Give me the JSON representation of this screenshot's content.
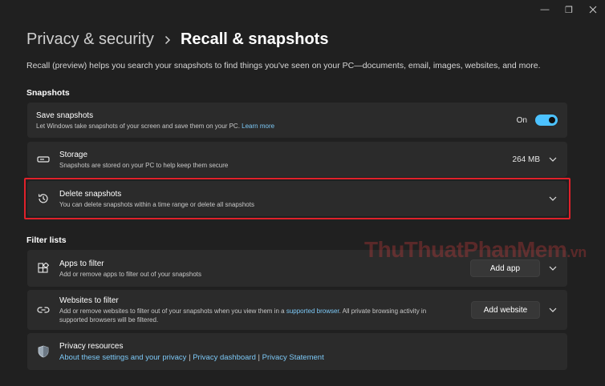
{
  "window": {
    "minimize": "—",
    "restore": "❐"
  },
  "breadcrumb": {
    "parent": "Privacy & security",
    "current": "Recall & snapshots"
  },
  "description": "Recall (preview) helps you search your snapshots to find things you've seen on your PC—documents, email, images, websites, and more.",
  "snapshots": {
    "title": "Snapshots",
    "save": {
      "title": "Save snapshots",
      "subtitle": "Let Windows take snapshots of your screen and save them on your PC.",
      "link": "Learn more",
      "state_label": "On",
      "toggle_on": true
    },
    "storage": {
      "title": "Storage",
      "subtitle": "Snapshots are stored on your PC to help keep them secure",
      "value": "264 MB"
    },
    "delete": {
      "title": "Delete snapshots",
      "subtitle": "You can delete snapshots within a time range or delete all snapshots"
    }
  },
  "filter_lists": {
    "title": "Filter lists",
    "apps": {
      "title": "Apps to filter",
      "subtitle": "Add or remove apps to filter out of your snapshots",
      "button": "Add app"
    },
    "websites": {
      "title": "Websites to filter",
      "subtitle_1": "Add or remove websites to filter out of your snapshots when you view them in a",
      "link": "supported browser",
      "subtitle_2": ". All private browsing activity in",
      "subtitle_3": "supported browsers will be filtered.",
      "button": "Add website"
    },
    "privacy": {
      "title": "Privacy resources",
      "links": [
        "About these settings and your privacy",
        "Privacy dashboard",
        "Privacy Statement"
      ],
      "separator": "|"
    }
  },
  "watermark": {
    "text": "ThuThuatPhanMem",
    "suffix": ".vn"
  },
  "colors": {
    "background": "#202020",
    "card": "#2b2b2b",
    "accent": "#4cc2ff",
    "link": "#7cc8f6",
    "highlight": "#e0212a"
  },
  "icons": {
    "storage": "storage-drive-icon",
    "delete": "history-icon",
    "apps": "apps-grid-icon",
    "websites": "link-icon",
    "privacy": "shield-icon"
  }
}
